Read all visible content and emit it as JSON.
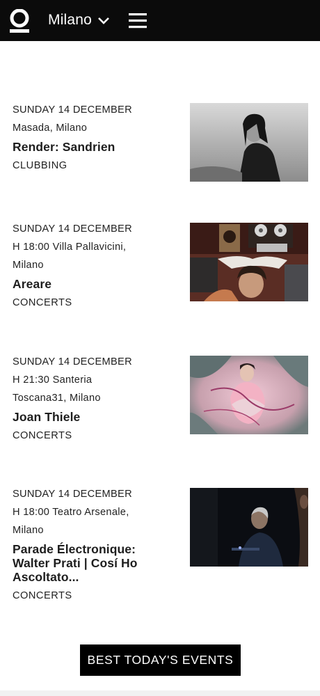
{
  "header": {
    "city": "Milano",
    "logo_icon": "circle-logo-icon",
    "chevron_icon": "chevron-down-icon",
    "menu_icon": "hamburger-menu-icon",
    "background": "#0b0b0b"
  },
  "events": [
    {
      "date": "SUNDAY 14 DECEMBER",
      "venue_lines": [
        "Masada, Milano"
      ],
      "title": "Render: Sandrien",
      "category": "CLUBBING",
      "image": "monochrome-portrait-photo"
    },
    {
      "date": "SUNDAY 14 DECEMBER",
      "venue_lines": [
        "H 18:00 Villa Pallavicini,",
        "Milano"
      ],
      "title": "Areare",
      "category": "CONCERTS",
      "image": "studio-tape-reel-photo"
    },
    {
      "date": "SUNDAY 14 DECEMBER",
      "venue_lines": [
        "H 21:30 Santeria",
        "Toscana31, Milano"
      ],
      "title": "Joan Thiele",
      "category": "CONCERTS",
      "image": "pink-crouching-figure-photo"
    },
    {
      "date": "SUNDAY 14 DECEMBER",
      "venue_lines": [
        "H 18:00 Teatro Arsenale,",
        "Milano"
      ],
      "title": "Parade Électronique: Walter Prati | Cosí Ho Ascoltato...",
      "category": "CONCERTS",
      "image": "dark-performer-photo"
    }
  ],
  "cta": {
    "label": "BEST TODAY'S EVENTS"
  }
}
